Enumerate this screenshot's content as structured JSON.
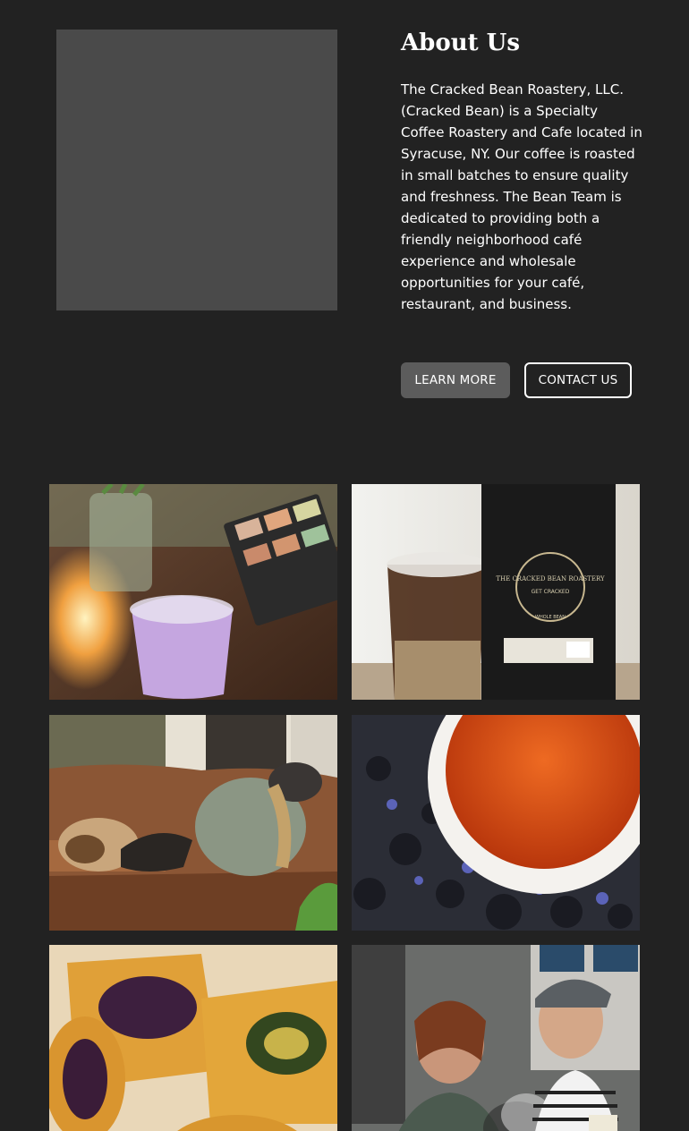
{
  "about": {
    "title": "About Us",
    "body": "The Cracked Bean Roastery, LLC. (Cracked Bean) is a Specialty Coffee Roastery and Cafe located in Syracuse, NY. Our coffee is roasted in small batches to ensure quality and freshness. The Bean Team is dedicated to providing both a friendly neighborhood café experience and wholesale opportunities for your café, restaurant, and business.",
    "learn_more_label": "LEARN MORE",
    "contact_label": "CONTACT US"
  },
  "gallery": {
    "photos": [
      {
        "subject": "lavender iced drink in a plastic cup beside a mason jar of flowers and a tea box"
      },
      {
        "subject": "iced coffee next to a black Cracked Bean Roastery coffee bag"
      },
      {
        "subject": "dog and woman in a cap on a brown leather couch"
      },
      {
        "subject": "cup of red tea over loose black tea leaves with blue petals"
      },
      {
        "subject": "berry and spinach pastries"
      },
      {
        "subject": "two smiling people at a cafe counter"
      }
    ],
    "coffee_bag_text": "THE CRACKED BEAN ROASTERY",
    "coffee_bag_tagline": "GET CRACKED",
    "coffee_bag_type": "WHOLE BEAN"
  },
  "colors": {
    "background": "#222222",
    "image_placeholder": "#4a4a4a",
    "learn_more_bg": "#5c5c5c",
    "text": "#ffffff"
  }
}
